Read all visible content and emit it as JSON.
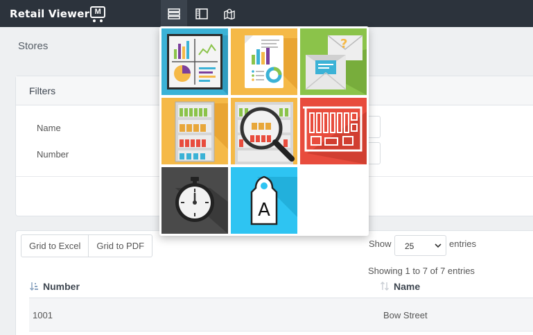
{
  "app": {
    "brand": "Retail Viewer",
    "brand_mark": "M"
  },
  "topbar": {
    "nav_icons": [
      "menu-list-icon",
      "sidebar-panel-icon",
      "map-icon"
    ]
  },
  "page": {
    "title": "Stores"
  },
  "filters": {
    "title": "Filters",
    "fields": [
      {
        "label": "Name",
        "value": ""
      },
      {
        "label": "Number",
        "value": ""
      }
    ]
  },
  "table": {
    "buttons": {
      "excel": "Grid to Excel",
      "pdf": "Grid to PDF"
    },
    "show_label": "Show",
    "entries_label": "entries",
    "page_size": "25",
    "info": "Showing 1 to 7 of 7 entries",
    "columns": [
      "Number",
      "Name"
    ],
    "rows": [
      {
        "number": "1001",
        "name": "Bow Street"
      }
    ]
  },
  "tile_menu": {
    "tiles": [
      {
        "icon": "dashboard-charts-icon",
        "color": "#3bb2d6"
      },
      {
        "icon": "report-document-icon",
        "color": "#f5b947"
      },
      {
        "icon": "mail-envelopes-icon",
        "color": "#8bc34a"
      },
      {
        "icon": "store-shelves-icon",
        "color": "#f5b947"
      },
      {
        "icon": "shelf-inspect-magnifier-icon",
        "color": "#f5b947"
      },
      {
        "icon": "floor-plan-icon",
        "color": "#e84c3d"
      },
      {
        "icon": "stopwatch-icon",
        "color": "#4a4a4a"
      },
      {
        "icon": "price-tag-icon",
        "color": "#2ec4f2",
        "label": "A"
      }
    ]
  },
  "colors": {
    "topbar": "#2c333c",
    "accent": "#3bb2d6",
    "page_bg": "#eef0f2"
  }
}
